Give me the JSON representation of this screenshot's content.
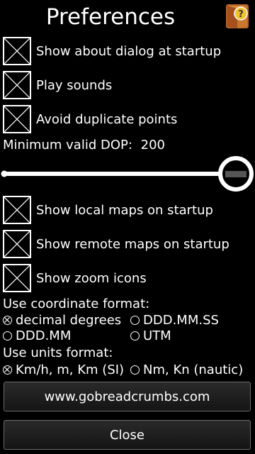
{
  "title": "Preferences",
  "help_icon": "help-book-icon",
  "checkboxes_top": [
    {
      "label": "Show about dialog at startup",
      "checked": true
    },
    {
      "label": "Play sounds",
      "checked": true
    },
    {
      "label": "Avoid duplicate points",
      "checked": true
    }
  ],
  "dop": {
    "label": "Minimum valid DOP:",
    "value": "200",
    "slider_fraction": 0.97
  },
  "checkboxes_bottom": [
    {
      "label": "Show local maps on startup",
      "checked": true
    },
    {
      "label": "Show remote maps on startup",
      "checked": true
    },
    {
      "label": "Show zoom icons",
      "checked": true
    }
  ],
  "coordinate_format": {
    "heading": "Use coordinate format:",
    "options": [
      "decimal degrees",
      "DDD.MM.SS",
      "DDD.MM",
      "UTM"
    ],
    "selected": "decimal degrees"
  },
  "units_format": {
    "heading": "Use units format:",
    "options": [
      "Km/h, m, Km (SI)",
      "Nm, Kn (nautic)"
    ],
    "selected": "Km/h, m, Km (SI)"
  },
  "website_button": "www.gobreadcrumbs.com",
  "close_button": "Close",
  "colors": {
    "background": "#000000",
    "text": "#ffffff",
    "button_border": "#6a6a6a"
  }
}
